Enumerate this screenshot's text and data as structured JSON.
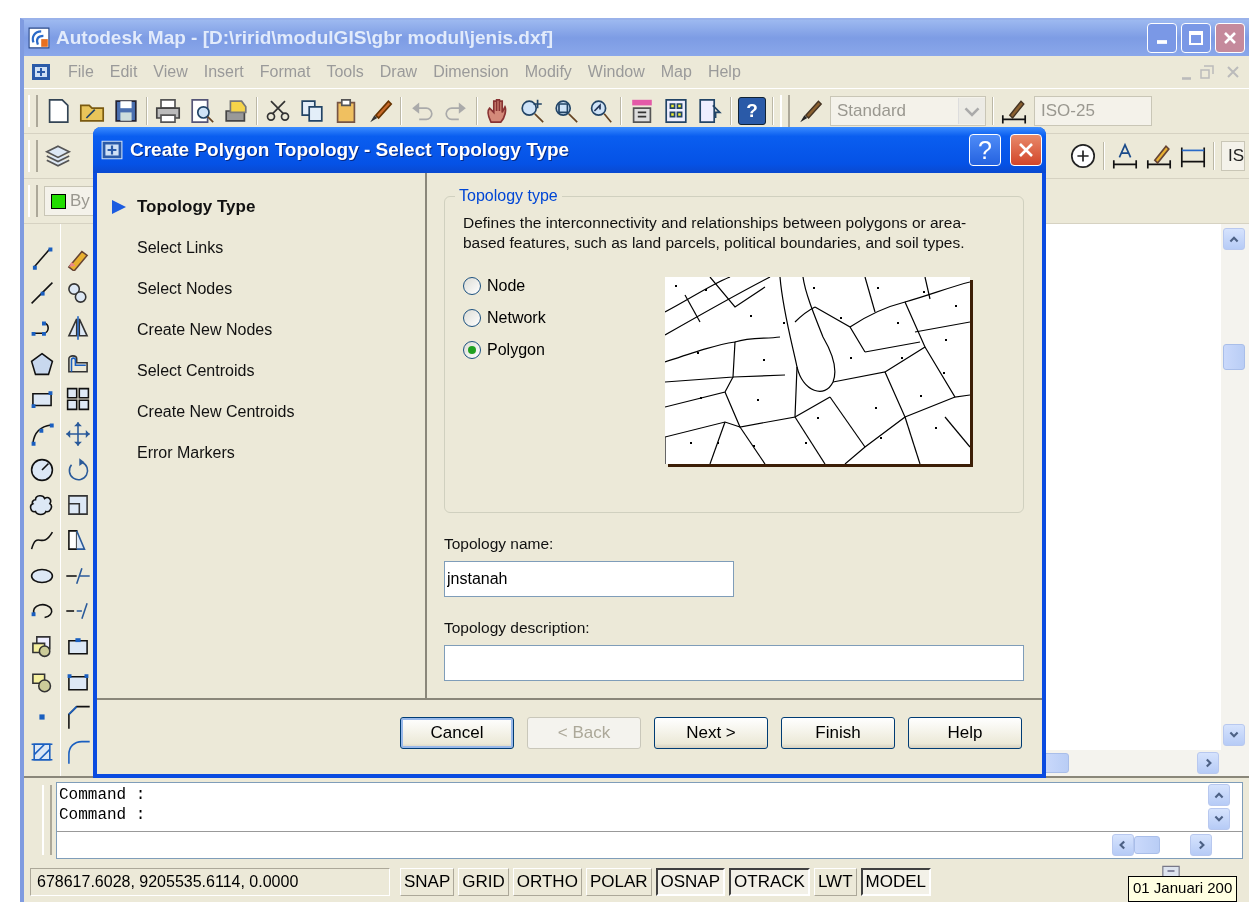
{
  "window": {
    "title": "Autodesk Map - [D:\\ririd\\modulGIS\\gbr modul\\jenis.dxf]"
  },
  "menu": [
    {
      "label": "File",
      "disabled": true
    },
    {
      "label": "Edit",
      "disabled": true
    },
    {
      "label": "View",
      "disabled": true
    },
    {
      "label": "Insert",
      "disabled": true
    },
    {
      "label": "Format",
      "disabled": true
    },
    {
      "label": "Tools",
      "disabled": true
    },
    {
      "label": "Draw",
      "disabled": true
    },
    {
      "label": "Dimension",
      "disabled": true
    },
    {
      "label": "Modify",
      "disabled": true
    },
    {
      "label": "Window",
      "disabled": true
    },
    {
      "label": "Map",
      "disabled": true
    },
    {
      "label": "Help",
      "disabled": true
    }
  ],
  "toolbar": {
    "help_glyph": "?",
    "text_style": {
      "value": "Standard",
      "disabled": true
    },
    "dim_style": {
      "value": "ISO-25",
      "disabled": true
    },
    "style_field": "IS",
    "color_control": "By"
  },
  "dialog": {
    "title": "Create Polygon Topology - Select Topology Type",
    "help_glyph": "?",
    "steps": [
      {
        "label": "Topology Type",
        "selected": true
      },
      {
        "label": "Select Links",
        "selected": false
      },
      {
        "label": "Select Nodes",
        "selected": false
      },
      {
        "label": "Create New Nodes",
        "selected": false
      },
      {
        "label": "Select Centroids",
        "selected": false
      },
      {
        "label": "Create New Centroids",
        "selected": false
      },
      {
        "label": "Error Markers",
        "selected": false
      }
    ],
    "group_title": "Topology type",
    "description": "Defines the interconnectivity and relationships between polygons or area-based features, such as land parcels, political boundaries, and soil types.",
    "options": [
      {
        "label": "Node",
        "selected": false
      },
      {
        "label": "Network",
        "selected": false
      },
      {
        "label": "Polygon",
        "selected": true
      }
    ],
    "name_label": "Topology name:",
    "name_value": "jnstanah",
    "description_label": "Topology description:",
    "buttons": [
      {
        "label": "Cancel",
        "disabled": false,
        "focused": true
      },
      {
        "label": "< Back",
        "disabled": true,
        "focused": false
      },
      {
        "label": "Next >",
        "disabled": false,
        "focused": false
      },
      {
        "label": "Finish",
        "disabled": false,
        "focused": false
      },
      {
        "label": "Help",
        "disabled": false,
        "focused": false
      }
    ]
  },
  "command": {
    "lines": [
      "Command :",
      "Command :"
    ]
  },
  "status_bar": {
    "coordinates": "678617.6028, 9205535.6114, 0.0000",
    "toggles": [
      {
        "label": "SNAP",
        "on": false
      },
      {
        "label": "GRID",
        "on": false
      },
      {
        "label": "ORTHO",
        "on": false
      },
      {
        "label": "POLAR",
        "on": false
      },
      {
        "label": "OSNAP",
        "on": true
      },
      {
        "label": "OTRACK",
        "on": true
      },
      {
        "label": "LWT",
        "on": false
      },
      {
        "label": "MODEL",
        "on": true
      }
    ],
    "tooltip": "01 Januari 200"
  }
}
